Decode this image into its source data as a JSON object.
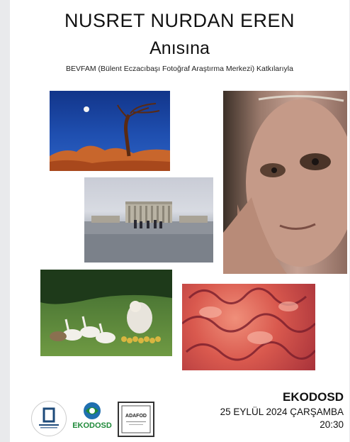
{
  "header": {
    "title_line1": "NUSRET NURDAN EREN",
    "title_line2": "Anısına",
    "subtitle": "BEVFAM (Bülent Eczacıbaşı Fotoğraf Araştırma Merkezi) Katkılarıyla"
  },
  "event": {
    "organizer": "EKODOSD",
    "date": "25 EYLÜL 2024 ÇARŞAMBA",
    "time": "20:30"
  },
  "logos": {
    "ekodosd_text": "EKODOSD",
    "adafod_text": "ADAFOD"
  },
  "colors": {
    "ekodosd_green": "#1f8a3a",
    "ekodosd_blue": "#1f6fb0"
  }
}
